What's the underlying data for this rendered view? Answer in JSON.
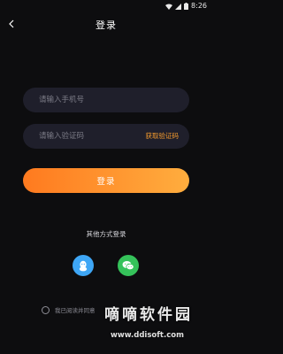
{
  "status_bar": {
    "time": "8:26",
    "icons": [
      "wifi-icon",
      "signal-icon",
      "battery-icon"
    ]
  },
  "header": {
    "title": "登录",
    "back_icon": "chevron-left-icon"
  },
  "form": {
    "phone_placeholder": "请输入手机号",
    "phone_value": "",
    "code_placeholder": "请输入验证码",
    "code_value": "",
    "get_code_label": "获取验证码",
    "login_label": "登录"
  },
  "other_login": {
    "label": "其他方式登录",
    "providers": [
      {
        "name": "QQ",
        "icon": "qq-icon",
        "color": "#3ea6f5"
      },
      {
        "name": "WeChat",
        "icon": "wechat-icon",
        "color": "#35c25a"
      }
    ]
  },
  "agreement": {
    "text": "我已阅读并同意",
    "checked": false
  },
  "watermark": {
    "text": "嘀嘀软件园",
    "url": "www.ddisoft.com"
  },
  "colors": {
    "background": "#0d0d0f",
    "field": "#1f1f2b",
    "accent": "#f39a2d",
    "button_start": "#ff7a1f",
    "button_end": "#ffad3e"
  }
}
